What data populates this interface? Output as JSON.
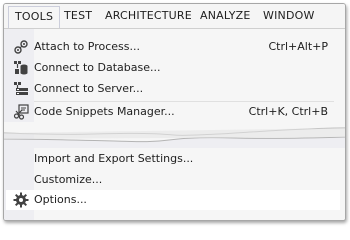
{
  "menubar": {
    "items": [
      {
        "label": "TOOLS",
        "active": true
      },
      {
        "label": "TEST"
      },
      {
        "label": "ARCHITECTURE"
      },
      {
        "label": "ANALYZE"
      },
      {
        "label": "WINDOW"
      }
    ]
  },
  "menu": {
    "top_items": [
      {
        "label": "Attach to Process...",
        "shortcut": "Ctrl+Alt+P",
        "icon": "attach-process-icon"
      },
      {
        "label": "Connect to Database...",
        "shortcut": "",
        "icon": "connect-database-icon"
      },
      {
        "label": "Connect to Server...",
        "shortcut": "",
        "icon": "connect-server-icon"
      },
      {
        "label": "Code Snippets Manager...",
        "shortcut": "Ctrl+K, Ctrl+B",
        "icon": "code-snippets-icon"
      }
    ],
    "bottom_items": [
      {
        "label": "Import and Export Settings...",
        "shortcut": ""
      },
      {
        "label": "Customize...",
        "shortcut": ""
      },
      {
        "label": "Options...",
        "shortcut": "",
        "icon": "gear-icon",
        "highlighted": true
      }
    ]
  },
  "colors": {
    "menubar_bg": "#f5f5f5",
    "menu_bg": "#f6f6f6",
    "highlight_bg": "#ffffff",
    "text": "#1e1e1e"
  }
}
